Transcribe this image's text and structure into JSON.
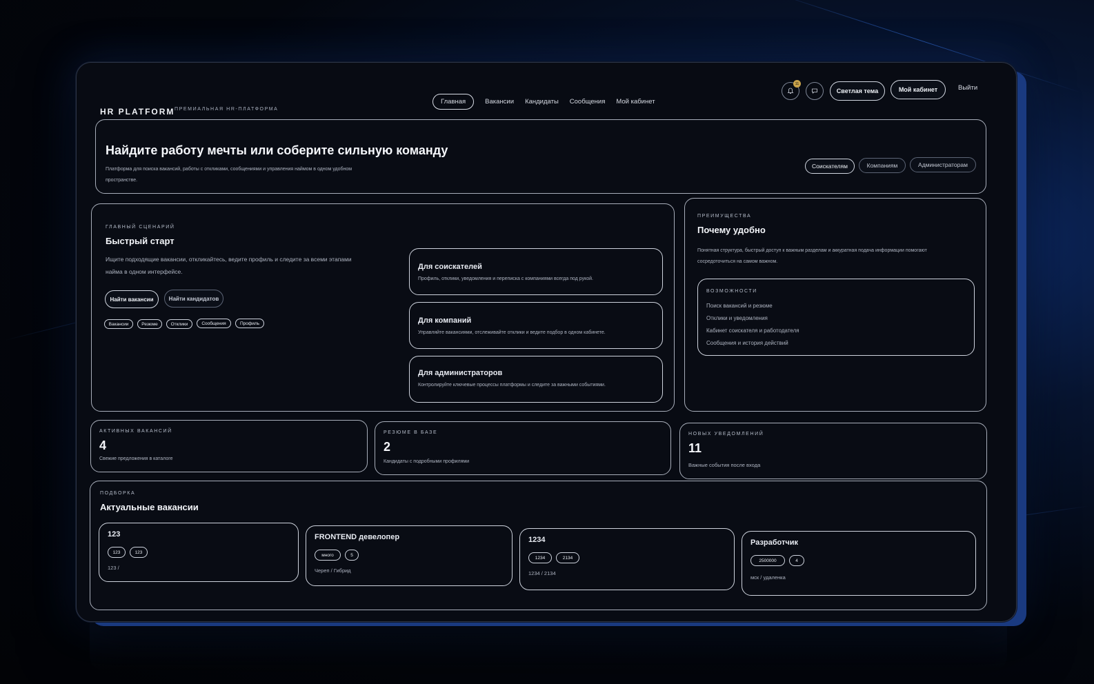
{
  "brand": {
    "logo": "HR PLATFORM",
    "tagline": "ПРЕМИАЛЬНАЯ HR-ПЛАТФОРМА"
  },
  "nav": {
    "items": [
      "Главная",
      "Вакансии",
      "Кандидаты",
      "Сообщения",
      "Мой кабинет"
    ],
    "active": "Главная"
  },
  "header": {
    "notifications_badge": "11",
    "theme_button": "Светлая тема",
    "cabinet_button": "Мой кабинет",
    "logout": "Выйти"
  },
  "hero": {
    "title": "Найдите работу мечты или соберите сильную команду",
    "subtitle_line1": "Платформа для поиска вакансий, работы с откликами, сообщениями и управления наймом в одном удобном",
    "subtitle_line2": "пространстве.",
    "audience_tabs": [
      "Соискателям",
      "Компаниям",
      "Администраторам"
    ]
  },
  "quick_start": {
    "eyebrow": "ГЛАВНЫЙ СЦЕНАРИЙ",
    "title": "Быстрый старт",
    "desc_line1": "Ищите подходящие вакансии, откликайтесь, ведите профиль и следите за всеми этапами",
    "desc_line2": "найма в одном интерфейсе.",
    "primary_button": "Найти вакансии",
    "secondary_button": "Найти кандидатов",
    "chips": [
      "Вакансии",
      "Резюме",
      "Отклики",
      "Сообщения",
      "Профиль"
    ],
    "roles": [
      {
        "title": "Для соискателей",
        "desc": "Профиль, отклики, уведомления и переписка с компаниями всегда под рукой."
      },
      {
        "title": "Для компаний",
        "desc": "Управляйте вакансиями, отслеживайте отклики и ведите подбор в одном кабинете."
      },
      {
        "title": "Для администраторов",
        "desc": "Контролируйте ключевые процессы платформы и следите за важными событиями."
      }
    ]
  },
  "advantages": {
    "eyebrow": "ПРЕИМУЩЕСТВА",
    "title": "Почему удобно",
    "desc_line1": "Понятная структура, быстрый доступ к важным разделам и аккуратная подача информации помогают",
    "desc_line2": "сосредоточиться на самом важном.",
    "features_eyebrow": "ВОЗМОЖНОСТИ",
    "features": [
      "Поиск вакансий и резюме",
      "Отклики и уведомления",
      "Кабинет соискателя и работодателя",
      "Сообщения и история действий"
    ]
  },
  "stats": [
    {
      "label": "АКТИВНЫХ ВАКАНСИЙ",
      "value": "4",
      "desc": "Свежие предложения в каталоге"
    },
    {
      "label": "РЕЗЮМЕ В БАЗЕ",
      "value": "2",
      "desc": "Кандидаты с подробными профилями"
    },
    {
      "label": "НОВЫХ УВЕДОМЛЕНИЙ",
      "value": "11",
      "desc": "Важные события после входа"
    }
  ],
  "vacancies": {
    "eyebrow": "ПОДБОРКА",
    "title": "Актуальные вакансии",
    "items": [
      {
        "title": "123",
        "tags": [
          "123",
          "123"
        ],
        "meta": "123 /"
      },
      {
        "title": "FRONTEND девелопер",
        "tags": [
          "много",
          "5"
        ],
        "meta": "Череп / Гибрид"
      },
      {
        "title": "1234",
        "tags": [
          "1234",
          "2134"
        ],
        "meta": "1234 / 2134"
      },
      {
        "title": "Разработчик",
        "tags": [
          "2500000",
          "4"
        ],
        "meta": "мск / удаленка"
      }
    ]
  },
  "colors": {
    "background": "#03060d",
    "panel": "#080b13",
    "accent_glow": "#1a3a80",
    "border": "#cfd4de"
  }
}
